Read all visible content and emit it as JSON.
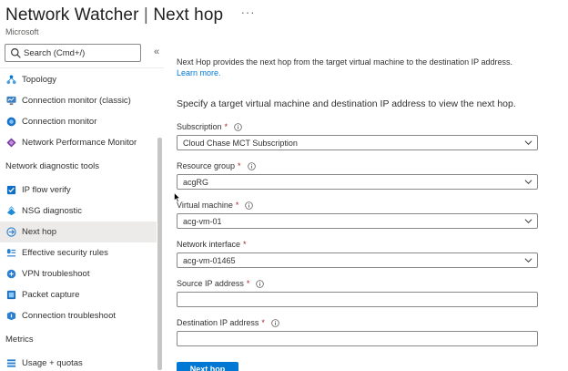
{
  "header": {
    "title_main": "Network Watcher",
    "title_sep": "|",
    "title_page": "Next hop",
    "more_label": "···",
    "subtitle": "Microsoft"
  },
  "sidebar": {
    "search_placeholder": "Search (Cmd+/)",
    "collapse_label": "«",
    "items_top": [
      {
        "label": "Topology",
        "icon": "topology-icon"
      },
      {
        "label": "Connection monitor (classic)",
        "icon": "connection-monitor-classic-icon"
      },
      {
        "label": "Connection monitor",
        "icon": "connection-monitor-icon"
      },
      {
        "label": "Network Performance Monitor",
        "icon": "network-performance-monitor-icon"
      }
    ],
    "section_diagnostic": "Network diagnostic tools",
    "items_diagnostic": [
      {
        "label": "IP flow verify",
        "icon": "ip-flow-verify-icon"
      },
      {
        "label": "NSG diagnostic",
        "icon": "nsg-diagnostic-icon"
      },
      {
        "label": "Next hop",
        "icon": "next-hop-icon",
        "active": true
      },
      {
        "label": "Effective security rules",
        "icon": "effective-security-rules-icon"
      },
      {
        "label": "VPN troubleshoot",
        "icon": "vpn-troubleshoot-icon"
      },
      {
        "label": "Packet capture",
        "icon": "packet-capture-icon"
      },
      {
        "label": "Connection troubleshoot",
        "icon": "connection-troubleshoot-icon"
      }
    ],
    "section_metrics": "Metrics",
    "items_metrics": [
      {
        "label": "Usage + quotas",
        "icon": "usage-quotas-icon"
      }
    ]
  },
  "main": {
    "intro_text": "Next Hop provides the next hop from the target virtual machine to the destination IP address.",
    "learn_more": "Learn more.",
    "lead_text": "Specify a target virtual machine and destination IP address to view the next hop.",
    "subscription": {
      "label": "Subscription",
      "required": "*",
      "value": "Cloud Chase MCT Subscription"
    },
    "resource_group": {
      "label": "Resource group",
      "required": "*",
      "value": "acgRG"
    },
    "virtual_machine": {
      "label": "Virtual machine",
      "required": "*",
      "value": "acg-vm-01"
    },
    "network_interface": {
      "label": "Network interface",
      "required": "*",
      "value": "acg-vm-01465"
    },
    "source_ip": {
      "label": "Source IP address",
      "required": "*",
      "value": ""
    },
    "destination_ip": {
      "label": "Destination IP address",
      "required": "*",
      "value": ""
    },
    "next_hop_button": "Next hop"
  },
  "colors": {
    "accent": "#0078d4",
    "required": "#a4262c",
    "active_bg": "#edebe9"
  }
}
